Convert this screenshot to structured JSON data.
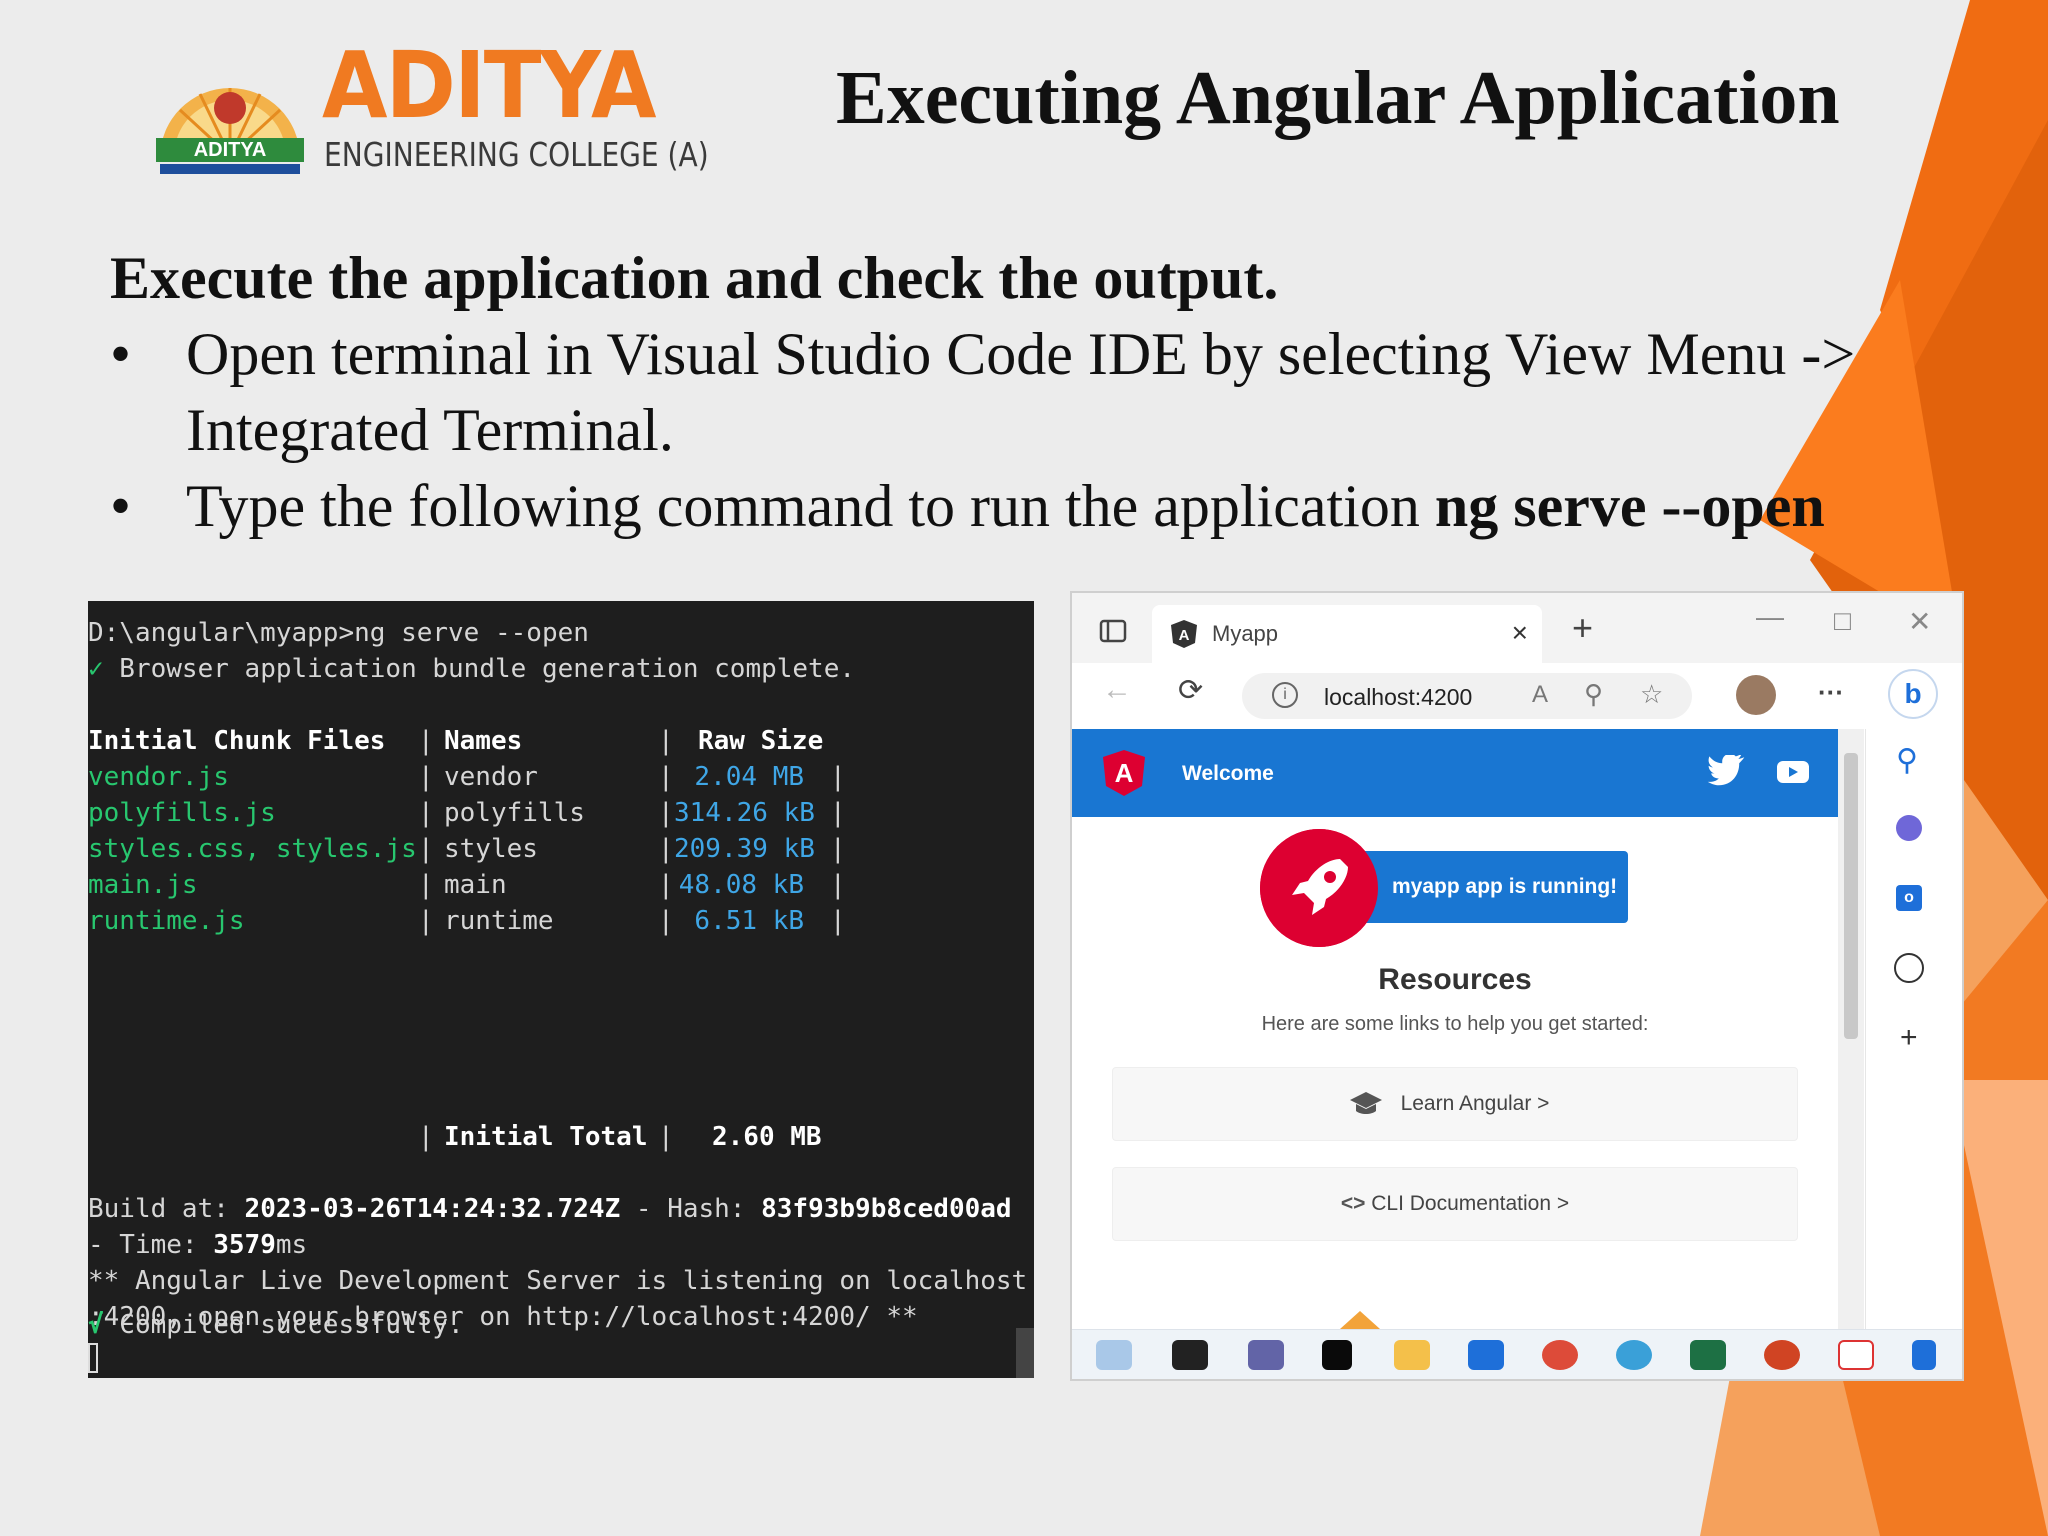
{
  "logo": {
    "name": "ADITYA",
    "subtitle": "ENGINEERING COLLEGE (A)",
    "seal_text": "ADITYA"
  },
  "slide": {
    "title": "Executing Angular Application",
    "heading": "Execute the application and check the output.",
    "bullets": [
      {
        "line1": "Open terminal in Visual Studio Code IDE by selecting View Menu ->",
        "line2": "Integrated Terminal."
      },
      {
        "text": "Type the following command to run the application ",
        "command": "ng serve --open"
      }
    ],
    "bullet_char": "•"
  },
  "terminal": {
    "command_line": "D:\\angular\\myapp>ng serve --open",
    "check_mark": "✓",
    "bundle_msg": " Browser application bundle generation complete.",
    "headers": {
      "files": "Initial Chunk Files",
      "names": "Names",
      "size": "Raw Size"
    },
    "rows": [
      {
        "file": "vendor.js",
        "name": "vendor",
        "size": "2.04 MB"
      },
      {
        "file": "polyfills.js",
        "name": "polyfills",
        "size": "314.26 kB"
      },
      {
        "file": "styles.css, styles.js",
        "name": "styles",
        "size": "209.39 kB"
      },
      {
        "file": "main.js",
        "name": "main",
        "size": "48.08 kB"
      },
      {
        "file": "runtime.js",
        "name": "runtime",
        "size": "6.51 kB"
      }
    ],
    "total_label": "Initial Total",
    "total_value": "2.60 MB",
    "build_prefix": "Build at: ",
    "build_time": "2023-03-26T14:24:32.724Z",
    "hash_prefix": " - Hash: ",
    "hash": "83f93b9b8ced00ad",
    "time_prefix": "- Time: ",
    "time_value": "3579",
    "time_unit": "ms",
    "server_line1": "** Angular Live Development Server is listening on localhost",
    "server_line2": ":4200, open your browser on http://localhost:4200/ **",
    "compiled_check": "√",
    "compiled": " Compiled successfully."
  },
  "browser": {
    "tab_title": "Myapp",
    "tab_close": "×",
    "new_tab": "+",
    "url": "localhost:4200",
    "more": "···",
    "welcome": "Welcome",
    "running": "myapp app is running!",
    "resources": "Resources",
    "resources_sub": "Here are some links to help you get started:",
    "cards": [
      {
        "label": "Learn Angular >"
      },
      {
        "label": "CLI Documentation >"
      }
    ],
    "sidebar_plus": "+"
  },
  "colors": {
    "accent_orange": "#f07a21",
    "angular_red": "#dd0031",
    "angular_blue": "#1976d2",
    "terminal_bg": "#1e1e1e",
    "terminal_green": "#28c76f",
    "terminal_blue": "#3fa6e6"
  }
}
